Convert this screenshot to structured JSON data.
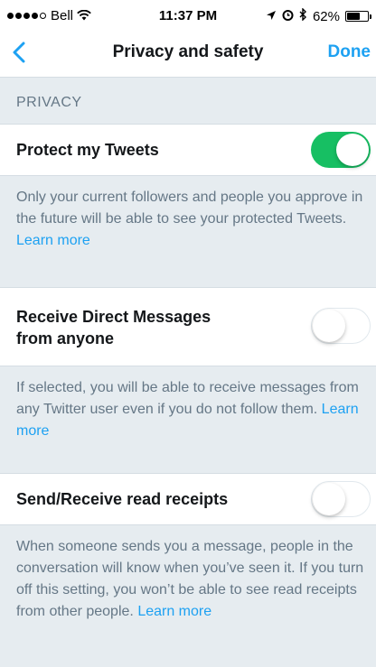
{
  "status_bar": {
    "carrier": "Bell",
    "time": "11:37 PM",
    "battery": "62%",
    "battery_level": 0.62
  },
  "navbar": {
    "title": "Privacy and safety",
    "done_label": "Done"
  },
  "section": {
    "header": "PRIVACY"
  },
  "settings": [
    {
      "label": "Protect my Tweets",
      "on": true,
      "description": "Only your current followers and people you approve in the future will be able to see your protected Tweets.",
      "learn_more": "Learn more"
    },
    {
      "label_line1": "Receive Direct Messages",
      "label_line2": "from anyone",
      "on": false,
      "description": "If selected, you will be able to receive messages from any Twitter user even if you do not follow them.",
      "learn_more": "Learn more"
    },
    {
      "label": "Send/Receive read receipts",
      "on": false,
      "description": "When someone sends you a message, people in the conversation will know when you’ve seen it. If you turn off this setting, you won’t be able to see read receipts from other people.",
      "learn_more": "Learn more"
    }
  ],
  "colors": {
    "accent": "#1da1f2",
    "toggle_on": "#17bf63",
    "background": "#e6ecf0",
    "secondary_text": "#657786"
  }
}
